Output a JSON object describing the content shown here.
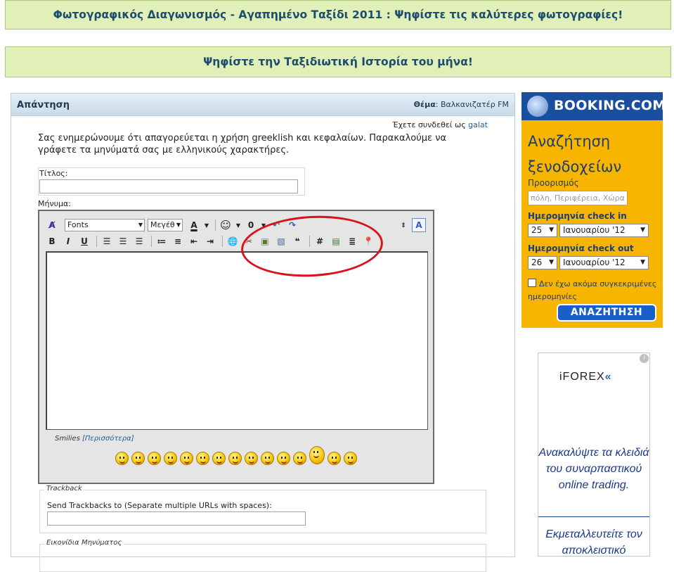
{
  "banners": {
    "contest": "Φωτογραφικός Διαγωνισμός - Αγαπημένο Ταξίδι 2011 : Ψηφίστε τις καλύτερες φωτογραφίες!",
    "story": "Ψηφίστε την Ταξιδιωτική Ιστορία του μήνα!"
  },
  "reply": {
    "title": "Απάντηση",
    "subject_label": "Θέμα",
    "subject_value": "Βαλκανιζατέρ FM",
    "logged_in_prefix": "Έχετε συνδεθεί ως",
    "username": "galat",
    "notice": "Σας ενημερώνουμε ότι απαγορεύεται η χρήση greeklish και κεφαλαίων. Παρακαλούμε να γράφετε τα μηνύματά σας με ελληνικούς χαρακτήρες.",
    "title_label": "Τίτλος:",
    "message_label": "Μήνυμα:"
  },
  "editor": {
    "font_select": "Fonts",
    "size_select": "Μεγέθ",
    "smilies_label": "Smilies",
    "smilies_more": "[Περισσότερα]",
    "smiley_count": 15
  },
  "trackback": {
    "legend": "Trackback",
    "label": "Send Trackbacks to (Separate multiple URLs with spaces):"
  },
  "post_icons": {
    "legend": "Εικονίδια Μηνύματος"
  },
  "booking": {
    "brand": "BOOKING.COM",
    "heading": "Αναζήτηση ξενοδοχείων",
    "dest_label": "Προορισμός",
    "dest_placeholder": "πόλη, Περιφέρεια, Χώρα",
    "checkin_label": "Ημερομηνία check in",
    "checkin_day": "25",
    "checkin_month": "Ιανουαρίου '12",
    "checkout_label": "Ημερομηνία check out",
    "checkout_day": "26",
    "checkout_month": "Ιανουαρίου '12",
    "no_dates_label": "Δεν έχω ακόμα συγκεκριμένες ημερομηνίες",
    "search_button": "ΑΝΑΖΗΤΗΣΗ"
  },
  "ad": {
    "brand_prefix": "iFOREX",
    "brand_mark": "«",
    "line1": "Ανακαλύψτε τα κλειδιά του συναρπαστικού online trading.",
    "line2": "Εκμεταλλευτείτε τον αποκλειστικό"
  }
}
